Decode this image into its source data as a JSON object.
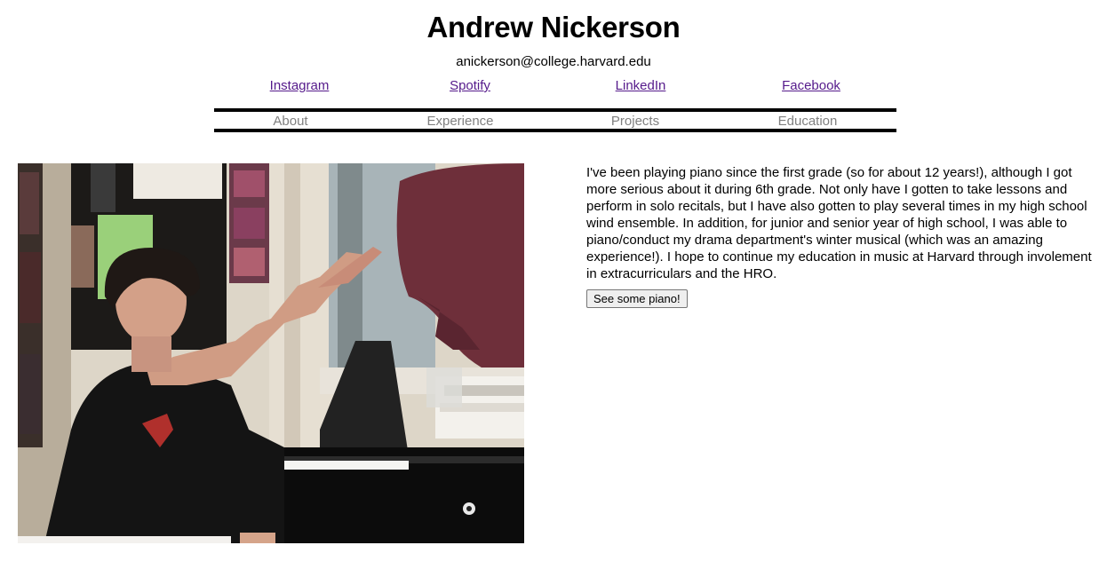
{
  "header": {
    "name": "Andrew Nickerson",
    "email": "anickerson@college.harvard.edu"
  },
  "social_links": [
    {
      "label": "Instagram",
      "icon": "instagram-icon"
    },
    {
      "label": "Spotify",
      "icon": "spotify-icon"
    },
    {
      "label": "LinkedIn",
      "icon": "linkedin-icon"
    },
    {
      "label": "Facebook",
      "icon": "facebook-icon"
    }
  ],
  "nav": {
    "items": [
      "About",
      "Experience",
      "Projects",
      "Education"
    ]
  },
  "about": {
    "photo": "photo of person playing piano",
    "text": "I've been playing piano since the first grade (so for about 12 years!), although I got more serious about it during 6th grade. Not only have I gotten to take lessons and perform in solo recitals, but I have also gotten to play several times in my high school wind ensemble. In addition, for junior and senior year of high school, I was able to piano/conduct my drama department's winter musical (which was an amazing experience!). I hope to continue my education in music at Harvard through involement in extracurriculars and the HRO.",
    "button_label": "See some piano!"
  },
  "colors": {
    "link": "#551a8b",
    "nav_text": "#808080",
    "nav_border": "#000000"
  }
}
